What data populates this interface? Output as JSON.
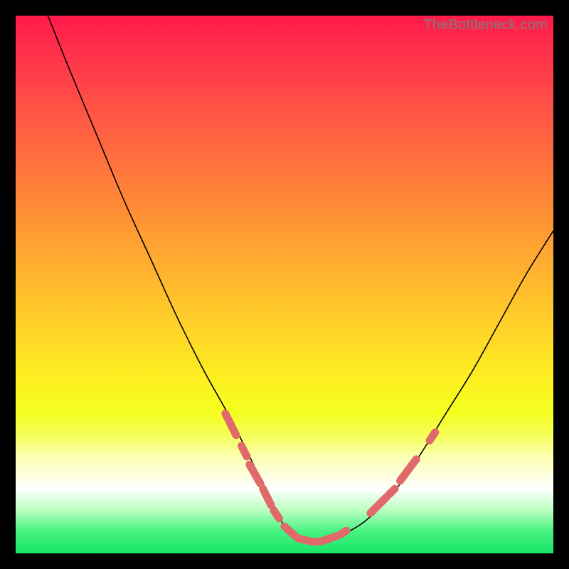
{
  "watermark": "TheBottleneck.com",
  "colors": {
    "background_frame": "#000000",
    "curve": "#000000",
    "dash": "#e06a6a",
    "gradient_top": "#ff1a4a",
    "gradient_bottom": "#18e468"
  },
  "chart_data": {
    "type": "line",
    "title": "",
    "xlabel": "",
    "ylabel": "",
    "xlim": [
      0,
      100
    ],
    "ylim": [
      0,
      100
    ],
    "grid": false,
    "legend": null,
    "annotations": [
      "TheBottleneck.com"
    ],
    "series": [
      {
        "name": "bottleneck-curve",
        "x": [
          6,
          10,
          15,
          20,
          25,
          30,
          35,
          40,
          45,
          48,
          50,
          52,
          55,
          58,
          60,
          65,
          70,
          75,
          80,
          85,
          90,
          95,
          100
        ],
        "y": [
          100,
          90,
          78,
          66,
          55,
          44,
          34,
          25,
          15,
          9,
          5,
          3,
          2,
          2,
          3,
          6,
          11,
          18,
          26,
          34,
          43,
          52,
          60
        ]
      }
    ],
    "highlight_segments": [
      {
        "x0": 39,
        "y0": 26,
        "x1": 41,
        "y1": 22
      },
      {
        "x0": 42,
        "y0": 20,
        "x1": 43,
        "y1": 18
      },
      {
        "x0": 43.5,
        "y0": 16.5,
        "x1": 45.5,
        "y1": 13
      },
      {
        "x0": 46,
        "y0": 12,
        "x1": 47.5,
        "y1": 9
      },
      {
        "x0": 48,
        "y0": 8,
        "x1": 49,
        "y1": 6.5
      },
      {
        "x0": 50,
        "y0": 5,
        "x1": 52,
        "y1": 3.2
      },
      {
        "x0": 52.5,
        "y0": 2.8,
        "x1": 55,
        "y1": 2.2
      },
      {
        "x0": 55.5,
        "y0": 2.2,
        "x1": 56.5,
        "y1": 2.2
      },
      {
        "x0": 57,
        "y0": 2.3,
        "x1": 60,
        "y1": 3.3
      },
      {
        "x0": 60.5,
        "y0": 3.6,
        "x1": 61.5,
        "y1": 4.2
      },
      {
        "x0": 66,
        "y0": 7.5,
        "x1": 69,
        "y1": 10.5
      },
      {
        "x0": 69.5,
        "y0": 11,
        "x1": 70.5,
        "y1": 12
      },
      {
        "x0": 71.5,
        "y0": 13.5,
        "x1": 74.5,
        "y1": 17.5
      },
      {
        "x0": 77,
        "y0": 21,
        "x1": 78,
        "y1": 22.5
      }
    ]
  }
}
